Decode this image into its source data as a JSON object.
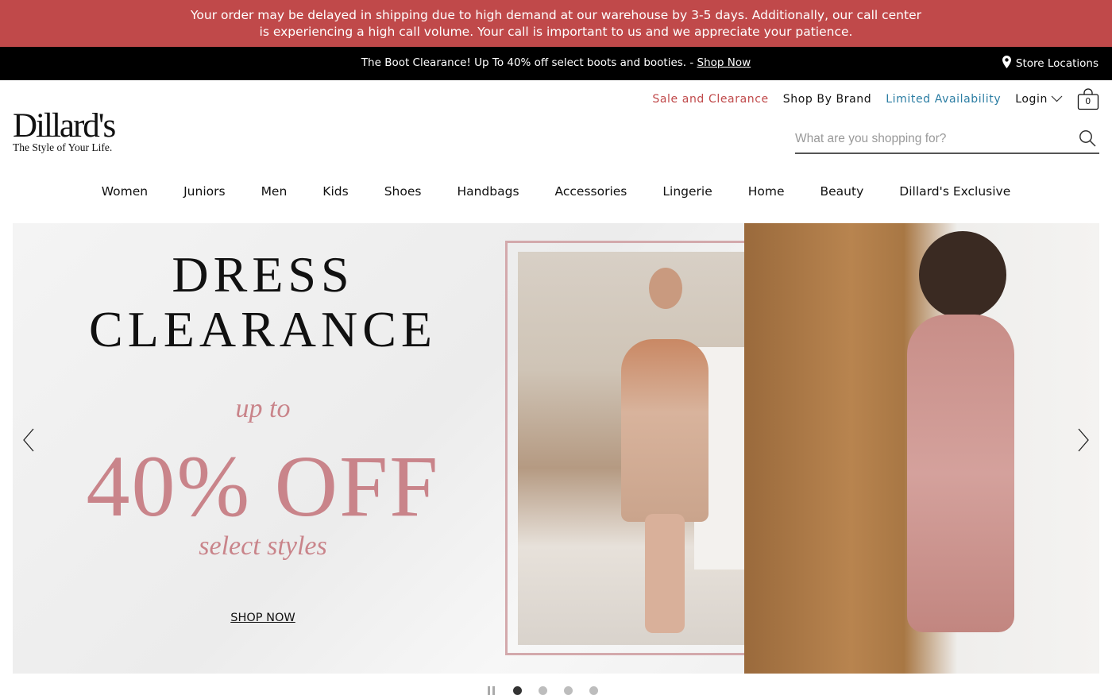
{
  "alert": {
    "line1": "Your order may be delayed in shipping due to high demand at our warehouse by 3-5 days. Additionally, our call center",
    "line2": "is experiencing a high call volume. Your call is important to us and we appreciate your patience."
  },
  "promo": {
    "text": "The Boot Clearance! Up To 40% off select boots and booties. - ",
    "link": "Shop Now",
    "store_locations": "Store Locations"
  },
  "logo": {
    "name": "Dillard's",
    "tagline": "The Style of Your Life."
  },
  "utility": {
    "sale": "Sale and Clearance",
    "brand": "Shop By Brand",
    "limited": "Limited Availability",
    "login": "Login",
    "bag_count": "0"
  },
  "search": {
    "placeholder": "What are you shopping for?"
  },
  "nav": [
    "Women",
    "Juniors",
    "Men",
    "Kids",
    "Shoes",
    "Handbags",
    "Accessories",
    "Lingerie",
    "Home",
    "Beauty",
    "Dillard's Exclusive"
  ],
  "hero": {
    "title1": "DRESS",
    "title2": "CLEARANCE",
    "upto": "up to",
    "off": "40% OFF",
    "select": "select styles",
    "cta": "SHOP NOW"
  },
  "colors": {
    "alert_bg": "#c0494a",
    "sale": "#c0494a",
    "limited": "#2b7da3",
    "accent_pink": "#c9848a"
  }
}
